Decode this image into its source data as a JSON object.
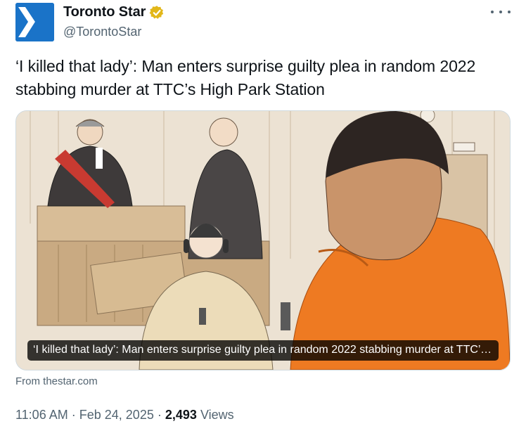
{
  "account": {
    "display_name": "Toronto Star",
    "handle": "@TorontoStar",
    "verified_badge": "gold-verified-icon",
    "avatar_color": "#1a73c8"
  },
  "tweet": {
    "text": "‘I killed that lady’: Man enters surprise guilty plea in random 2022 stabbing murder at TTC’s High Park Station"
  },
  "card": {
    "image_description_icon": "courtroom-sketch-image",
    "title": "‘I killed that lady’: Man enters surprise guilty plea in random 2022 stabbing murder at TTC’s High Park Station",
    "source": "From thestar.com"
  },
  "meta": {
    "time": "11:06 AM",
    "separator": "·",
    "date": "Feb 24, 2025",
    "views_count": "2,493",
    "views_label": "Views"
  },
  "colors": {
    "text_primary": "#0f1419",
    "text_secondary": "#536471",
    "border": "#cfd9de",
    "verified_gold": "#e2b719"
  }
}
